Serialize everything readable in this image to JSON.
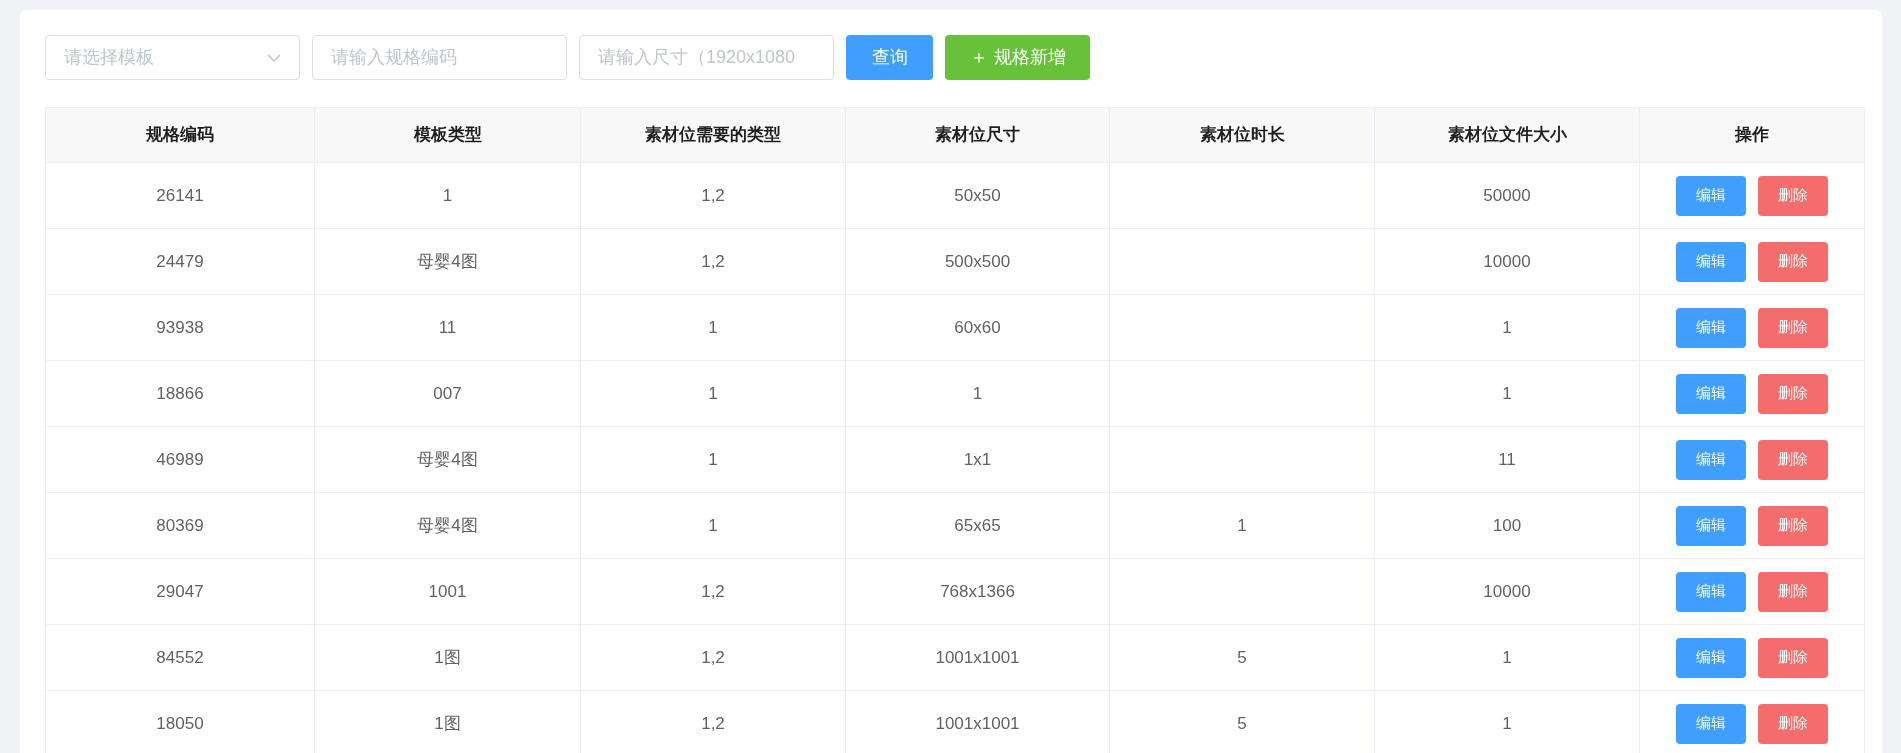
{
  "filters": {
    "template_select": {
      "placeholder": "请选择模板"
    },
    "code_field": {
      "placeholder": "请输入规格编码"
    },
    "size_field": {
      "placeholder": "请输入尺寸（1920x1080"
    },
    "query_button": "查询",
    "add_button": {
      "icon": "＋",
      "label": "规格新增"
    }
  },
  "table": {
    "columns": [
      "规格编码",
      "模板类型",
      "素材位需要的类型",
      "素材位尺寸",
      "素材位时长",
      "素材位文件大小",
      "操作"
    ],
    "rows": [
      {
        "cells": [
          "26141",
          "1",
          "1,2",
          "50x50",
          "",
          "50000"
        ],
        "actions": [
          "编辑",
          "删除"
        ]
      },
      {
        "cells": [
          "24479",
          "母婴4图",
          "1,2",
          "500x500",
          "",
          "10000"
        ],
        "actions": [
          "编辑",
          "删除"
        ]
      },
      {
        "cells": [
          "93938",
          "11",
          "1",
          "60x60",
          "",
          "1"
        ],
        "actions": [
          "编辑",
          "删除"
        ]
      },
      {
        "cells": [
          "18866",
          "007",
          "1",
          "1",
          "",
          "1"
        ],
        "actions": [
          "编辑",
          "删除"
        ]
      },
      {
        "cells": [
          "46989",
          "母婴4图",
          "1",
          "1x1",
          "",
          "11"
        ],
        "actions": [
          "编辑",
          "删除"
        ]
      },
      {
        "cells": [
          "80369",
          "母婴4图",
          "1",
          "65x65",
          "1",
          "100"
        ],
        "actions": [
          "编辑",
          "删除"
        ]
      },
      {
        "cells": [
          "29047",
          "1001",
          "1,2",
          "768x1366",
          "",
          "10000"
        ],
        "actions": [
          "编辑",
          "删除"
        ]
      },
      {
        "cells": [
          "84552",
          "1图",
          "1,2",
          "1001x1001",
          "5",
          "1"
        ],
        "actions": [
          "编辑",
          "删除"
        ]
      },
      {
        "cells": [
          "18050",
          "1图",
          "1,2",
          "1001x1001",
          "5",
          "1"
        ],
        "actions": [
          "编辑",
          "删除"
        ]
      }
    ]
  }
}
